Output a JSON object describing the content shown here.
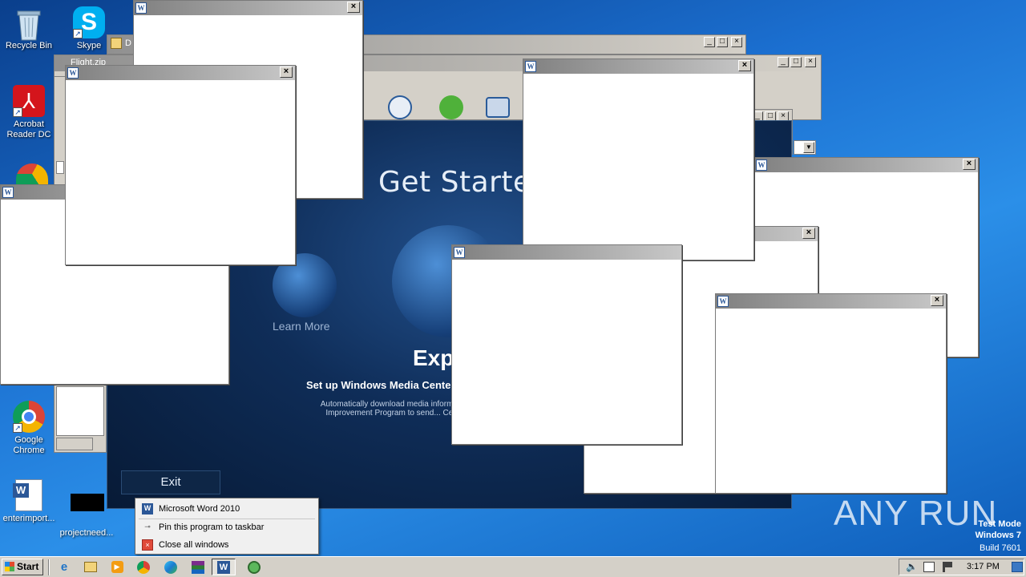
{
  "desktop_icons": [
    {
      "label": "Recycle Bin"
    },
    {
      "label": "Skype"
    },
    {
      "label": "Acrobat Reader DC"
    },
    {
      "label": "Google Chrome"
    },
    {
      "label": "enterimport..."
    },
    {
      "label": "projectneed..."
    }
  ],
  "background_windows": {
    "top_window_fragment": "D",
    "second_window_fragment": "Flight.zip"
  },
  "media_center": {
    "title": "Get Started",
    "learn_more": "Learn More",
    "express": "Expr",
    "setup_text": "Set up Windows Media Center",
    "description": "Automatically download media information... Experience Improvement Program to send... Center's usage an...",
    "exit_label": "Exit"
  },
  "jump_list": {
    "items": [
      {
        "label": "Microsoft Word 2010",
        "icon": "word-icon"
      },
      {
        "label": "Pin this program to taskbar",
        "icon": "pin-icon"
      },
      {
        "label": "Close all windows",
        "icon": "close-red-icon"
      }
    ]
  },
  "taskbar": {
    "start_label": "Start",
    "clock": "3:17 PM",
    "apps": [
      "ie-icon",
      "explorer-icon",
      "media-player-icon",
      "chrome-icon",
      "edge-icon",
      "winrar-icon",
      "word-icon",
      "media-center-icon"
    ]
  },
  "watermark": {
    "brand": "ANY RUN",
    "mode": "Test Mode",
    "os": "Windows 7",
    "build": "Build 7601"
  },
  "colors": {
    "desktop_blue": "#1b6fd0",
    "titlebar_dark": "#808080",
    "titlebar_light": "#c8c8c8",
    "classic_face": "#d4d0c8"
  }
}
